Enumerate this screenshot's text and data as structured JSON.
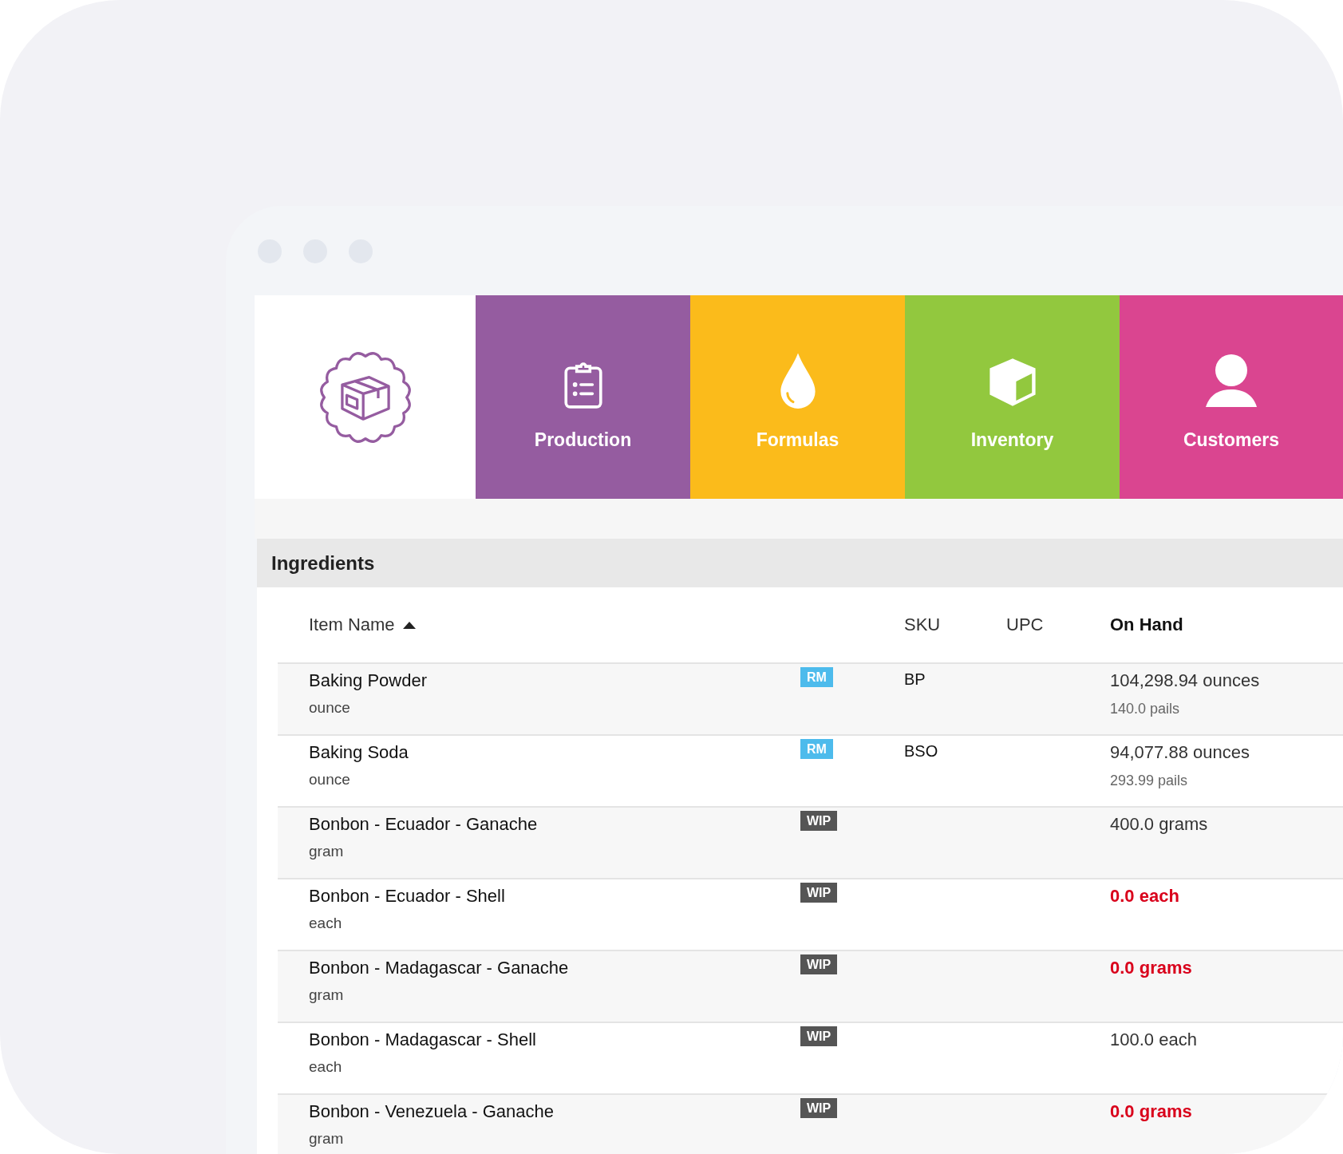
{
  "nav": [
    {
      "label": "Production",
      "color": "#955ca0"
    },
    {
      "label": "Formulas",
      "color": "#fbbb1b"
    },
    {
      "label": "Inventory",
      "color": "#92c83e"
    },
    {
      "label": "Customers",
      "color": "#da4590"
    }
  ],
  "panel": {
    "title": "Ingredients"
  },
  "table": {
    "columns": [
      {
        "label": "Item Name",
        "sorted": true
      },
      {
        "label": "SKU",
        "sorted": false
      },
      {
        "label": "UPC",
        "sorted": false
      },
      {
        "label": "On Hand",
        "sorted": false
      }
    ],
    "rows": [
      {
        "name": "Baking Powder",
        "unit": "ounce",
        "tag": {
          "text": "RM",
          "kind": "raw"
        },
        "sku": "BP",
        "on_hand": "104,298.94 ounces",
        "alt_amount": "140.0 pails",
        "low": false
      },
      {
        "name": "Baking Soda",
        "unit": "ounce",
        "tag": {
          "text": "RM",
          "kind": "raw"
        },
        "sku": "BSO",
        "on_hand": "94,077.88 ounces",
        "alt_amount": "293.99 pails",
        "low": false
      },
      {
        "name": "Bonbon - Ecuador - Ganache",
        "unit": "gram",
        "tag": {
          "text": "WIP",
          "kind": "wip"
        },
        "on_hand": "400.0 grams",
        "low": false
      },
      {
        "name": "Bonbon - Ecuador - Shell",
        "unit": "each",
        "tag": {
          "text": "WIP",
          "kind": "wip"
        },
        "on_hand": "0.0 each",
        "low": true
      },
      {
        "name": "Bonbon - Madagascar - Ganache",
        "unit": "gram",
        "tag": {
          "text": "WIP",
          "kind": "wip"
        },
        "on_hand": "0.0 grams",
        "low": true
      },
      {
        "name": "Bonbon - Madagascar - Shell",
        "unit": "each",
        "tag": {
          "text": "WIP",
          "kind": "wip"
        },
        "on_hand": "100.0 each",
        "low": false
      },
      {
        "name": "Bonbon - Venezuela - Ganache",
        "unit": "gram",
        "tag": {
          "text": "WIP",
          "kind": "wip"
        },
        "on_hand": "0.0 grams",
        "low": true
      }
    ]
  }
}
